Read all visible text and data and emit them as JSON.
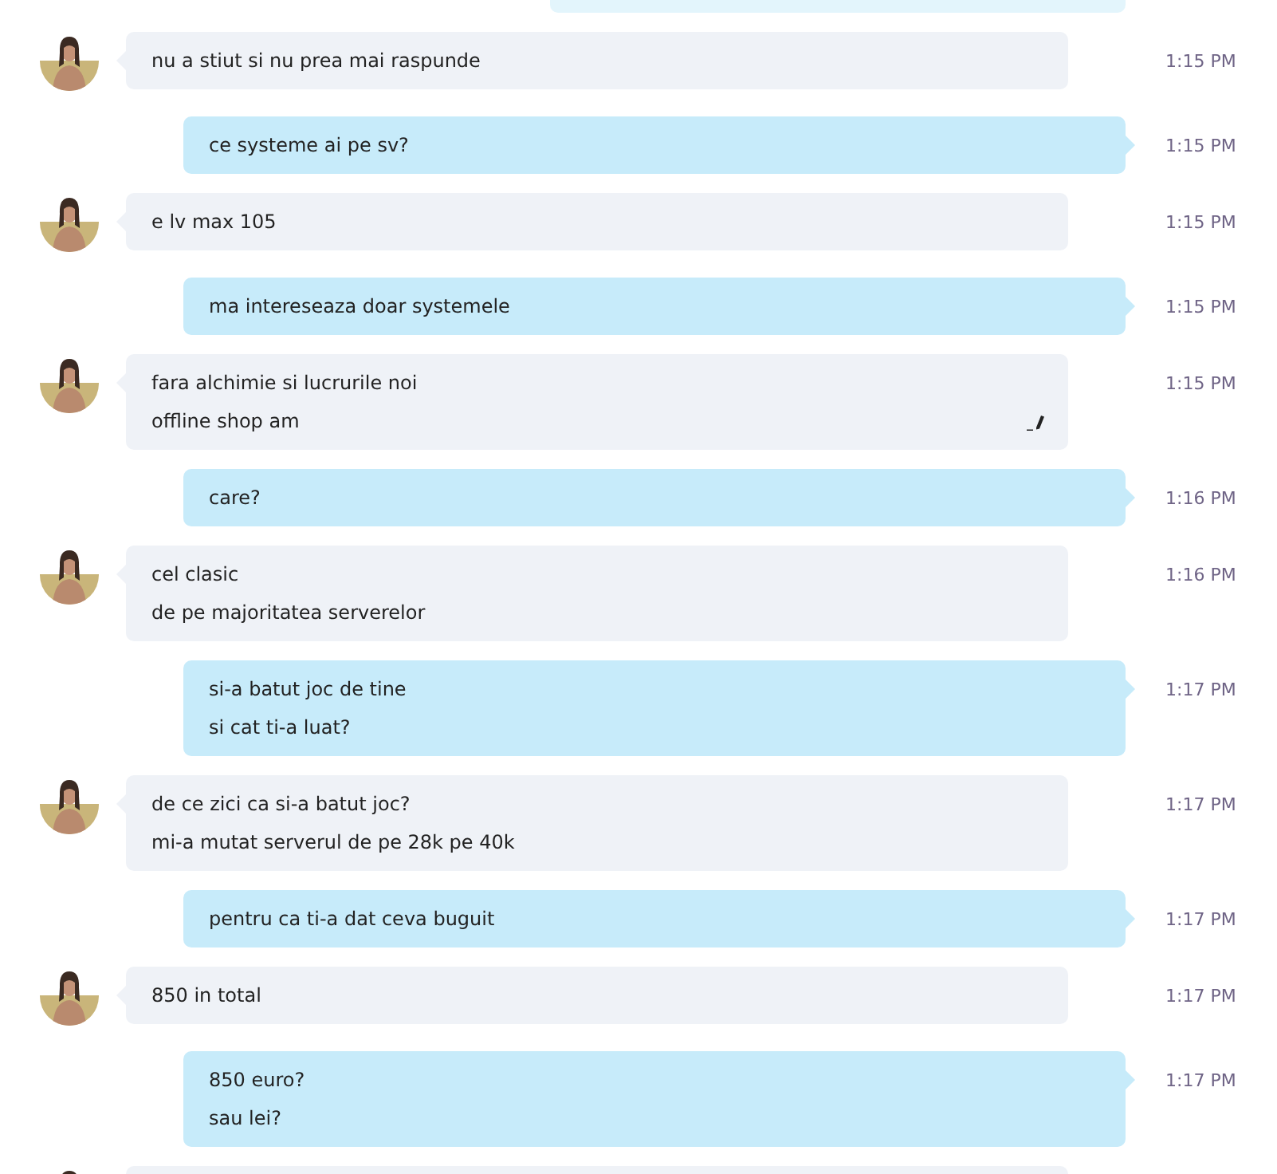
{
  "messages": [
    {
      "kind": "incoming",
      "lines": [
        "nu a stiut si nu prea mai raspunde"
      ],
      "time": "1:15 PM",
      "edited": false
    },
    {
      "kind": "outgoing",
      "lines": [
        "ce systeme ai pe sv?"
      ],
      "time": "1:15 PM",
      "edited": false
    },
    {
      "kind": "incoming",
      "lines": [
        "e lv max 105"
      ],
      "time": "1:15 PM",
      "edited": false
    },
    {
      "kind": "outgoing",
      "lines": [
        "ma intereseaza doar systemele"
      ],
      "time": "1:15 PM",
      "edited": false
    },
    {
      "kind": "incoming",
      "lines": [
        "fara alchimie si lucrurile noi",
        "offline shop am"
      ],
      "time": "1:15 PM",
      "edited": true
    },
    {
      "kind": "outgoing",
      "lines": [
        "care?"
      ],
      "time": "1:16 PM",
      "edited": false
    },
    {
      "kind": "incoming",
      "lines": [
        "cel clasic",
        "de pe majoritatea serverelor"
      ],
      "time": "1:16 PM",
      "edited": false
    },
    {
      "kind": "outgoing",
      "lines": [
        "si-a batut joc de tine",
        "si cat ti-a luat?"
      ],
      "time": "1:17 PM",
      "edited": false
    },
    {
      "kind": "incoming",
      "lines": [
        "de ce zici ca si-a batut joc?",
        "mi-a mutat serverul de pe 28k pe 40k"
      ],
      "time": "1:17 PM",
      "edited": false
    },
    {
      "kind": "outgoing",
      "lines": [
        "pentru ca ti-a dat ceva buguit"
      ],
      "time": "1:17 PM",
      "edited": false
    },
    {
      "kind": "incoming",
      "lines": [
        "850 in total"
      ],
      "time": "1:17 PM",
      "edited": false
    },
    {
      "kind": "outgoing",
      "lines": [
        "850 euro?",
        "sau lei?"
      ],
      "time": "1:17 PM",
      "edited": false
    }
  ]
}
